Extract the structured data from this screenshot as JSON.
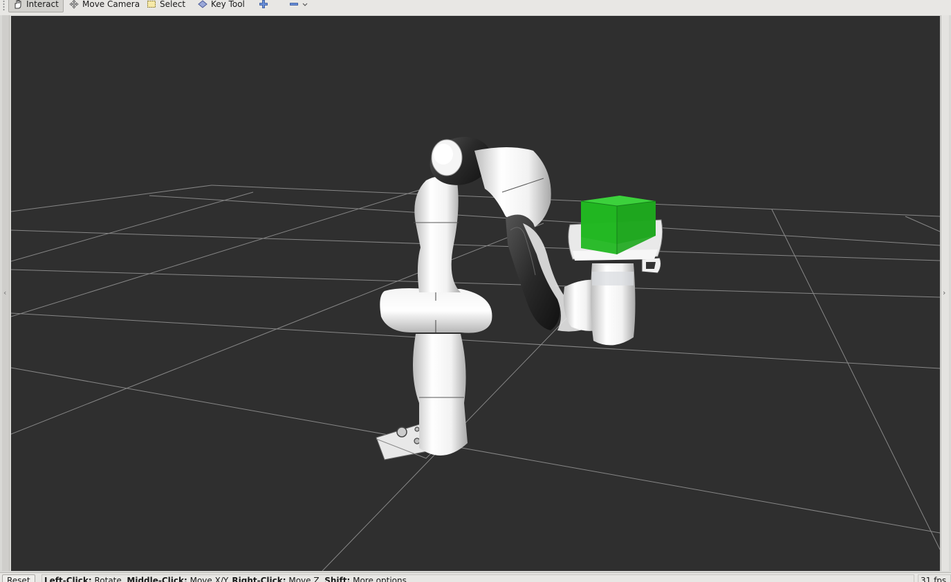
{
  "toolbar": {
    "tools": [
      {
        "label": "Interact",
        "icon": "hand-icon",
        "active": true
      },
      {
        "label": "Move Camera",
        "icon": "move-camera-icon",
        "active": false
      },
      {
        "label": "Select",
        "icon": "select-icon",
        "active": false
      },
      {
        "label": "Key Tool",
        "icon": "key-tool-icon",
        "active": false
      }
    ],
    "add_tool_icon": "plus-icon",
    "remove_tool_icon": "minus-icon",
    "dropdown_icon": "chevron-down-icon"
  },
  "viewport": {
    "background_color": "#2f2f2f",
    "grid_color": "#a0a0a0",
    "object_color": "#22b822",
    "left_collapse_icon": "chevron-left-icon",
    "right_collapse_icon": "chevron-right-icon"
  },
  "statusbar": {
    "reset_label": "Reset",
    "hint_parts": [
      {
        "key": "Left-Click:",
        "action": " Rotate. "
      },
      {
        "key": "Middle-Click:",
        "action": " Move X/Y. "
      },
      {
        "key": "Right-Click:",
        "action": " Move Z. "
      },
      {
        "key": "Shift:",
        "action": " More options."
      }
    ],
    "fps": "31 fps"
  }
}
